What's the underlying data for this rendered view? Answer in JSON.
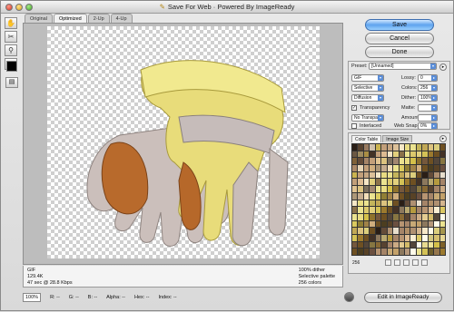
{
  "window": {
    "title": "Save For Web · Powered By ImageReady"
  },
  "tools": {
    "items": [
      "hand-tool",
      "slice-select-tool",
      "zoom-tool",
      "eyedropper-tool"
    ],
    "preview_icon": "preview-in-browser-icon"
  },
  "tabs": [
    {
      "label": "Original"
    },
    {
      "label": "Optimized"
    },
    {
      "label": "2-Up"
    },
    {
      "label": "4-Up"
    }
  ],
  "image_info": {
    "format": "GIF",
    "size": "129.4K",
    "time": "47 sec @ 28.8 Kbps",
    "dither": "100% dither",
    "palette": "Selective palette",
    "colors": "256 colors"
  },
  "statusbar": {
    "zoom": "100%",
    "r": "R: --",
    "g": "G: --",
    "b": "B: --",
    "alpha": "Alpha: --",
    "hex": "Hex: --",
    "index": "Index: --"
  },
  "buttons": {
    "save": "Save",
    "cancel": "Cancel",
    "done": "Done",
    "edit": "Edit in ImageReady"
  },
  "settings": {
    "preset_label": "Preset:",
    "preset_value": "[Unnamed]",
    "format_value": "GIF",
    "lossy_label": "Lossy:",
    "lossy_value": "0",
    "reduction_value": "Selective",
    "colors_label": "Colors:",
    "colors_value": "256",
    "dither_algo_value": "Diffusion",
    "dither_label": "Dither:",
    "dither_value": "100%",
    "transparency_label": "Transparency",
    "transparency_checked": true,
    "matte_label": "Matte:",
    "matte_value": "",
    "transparency_dither_value": "No Transpar...",
    "amount_label": "Amount:",
    "amount_value": "",
    "interlaced_label": "Interlaced",
    "interlaced_checked": false,
    "websnap_label": "Web Snap:",
    "websnap_value": "0%"
  },
  "color_table": {
    "tab_color_table": "Color Table",
    "tab_image_size": "Image Size",
    "count": "256"
  },
  "palette_colors": [
    "#2a1e16",
    "#4a3828",
    "#6b5040",
    "#8a6a52",
    "#a58468",
    "#c29f7a",
    "#ddbb92",
    "#efd7ad",
    "#f6e8c8",
    "#fffbea",
    "#ebe390",
    "#e2d468",
    "#d4c04a",
    "#c0a63a",
    "#9c7a2e",
    "#6e5022"
  ]
}
